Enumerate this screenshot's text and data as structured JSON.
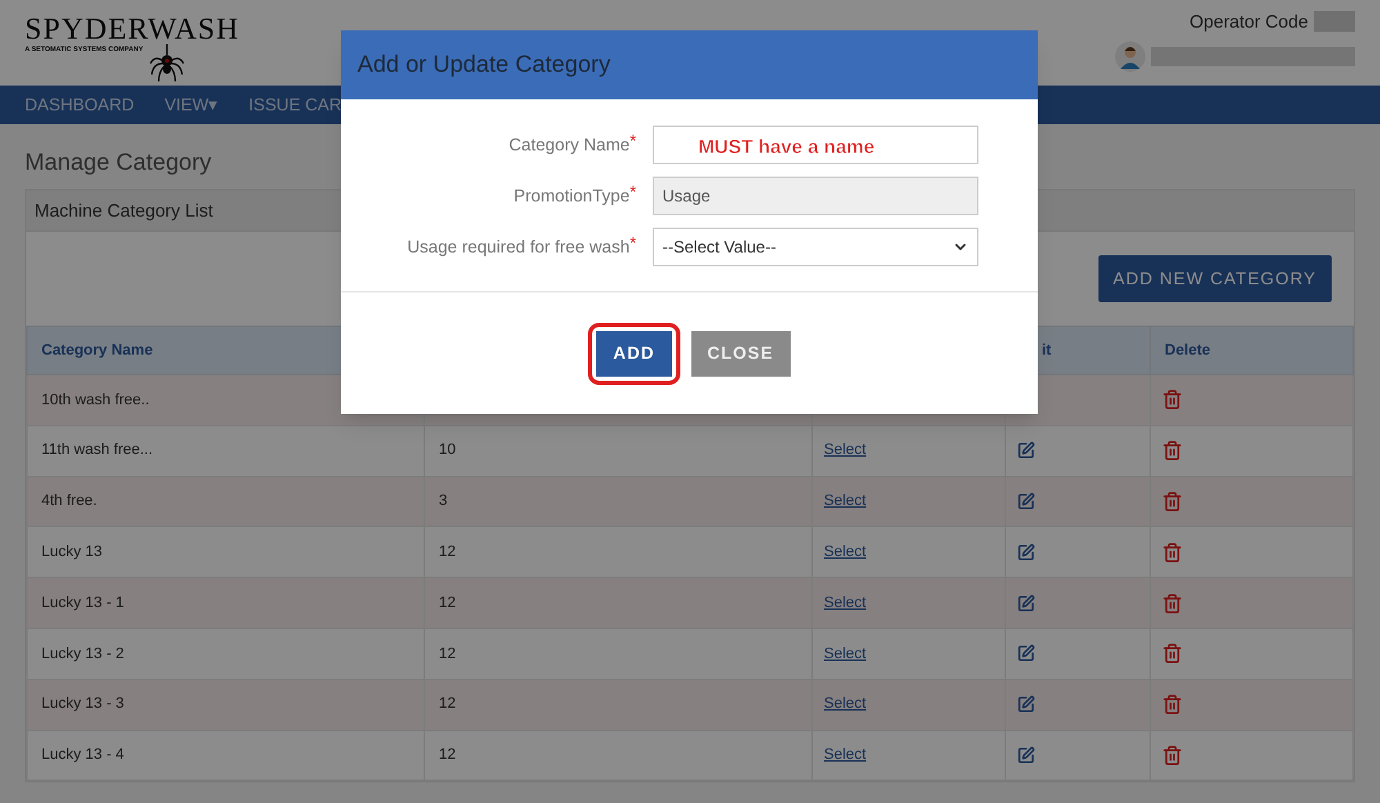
{
  "logo": {
    "name": "SPYDERWASH",
    "tagline": "A SETOMATIC SYSTEMS COMPANY"
  },
  "header": {
    "operator_label": "Operator Code"
  },
  "nav": [
    "DASHBOARD",
    "VIEW▾",
    "ISSUE CAR"
  ],
  "page_title": "Manage Category",
  "panel": {
    "title": "Machine Category List",
    "add_button": "ADD NEW CATEGORY"
  },
  "table": {
    "columns": [
      "Category Name",
      "it",
      "Delete"
    ],
    "rows": [
      {
        "name": "10th wash free.."
      },
      {
        "name": "11th wash free...",
        "usage": "10",
        "link": "Select"
      },
      {
        "name": "4th free.",
        "usage": "3",
        "link": "Select"
      },
      {
        "name": "Lucky 13",
        "usage": "12",
        "link": "Select"
      },
      {
        "name": "Lucky 13 - 1",
        "usage": "12",
        "link": "Select"
      },
      {
        "name": "Lucky 13 - 2",
        "usage": "12",
        "link": "Select"
      },
      {
        "name": "Lucky 13 - 3",
        "usage": "12",
        "link": "Select"
      },
      {
        "name": "Lucky 13 - 4",
        "usage": "12",
        "link": "Select"
      }
    ]
  },
  "modal": {
    "title": "Add or Update Category",
    "fields": [
      {
        "kind": "text",
        "label": "Category Name",
        "required_mark": "*",
        "disabled": false
      },
      {
        "kind": "text",
        "label": "PromotionType",
        "required_mark": "*",
        "value": "Usage",
        "disabled": true
      },
      {
        "kind": "select",
        "label": "Usage required for free wash",
        "required_mark": "*",
        "value": "--Select Value--",
        "disabled": false
      }
    ],
    "buttons": [
      {
        "label": "ADD",
        "kind": "primary",
        "highlighted": true
      },
      {
        "label": "CLOSE",
        "kind": "secondary",
        "highlighted": false
      }
    ]
  },
  "annotation": "MUST have a name"
}
